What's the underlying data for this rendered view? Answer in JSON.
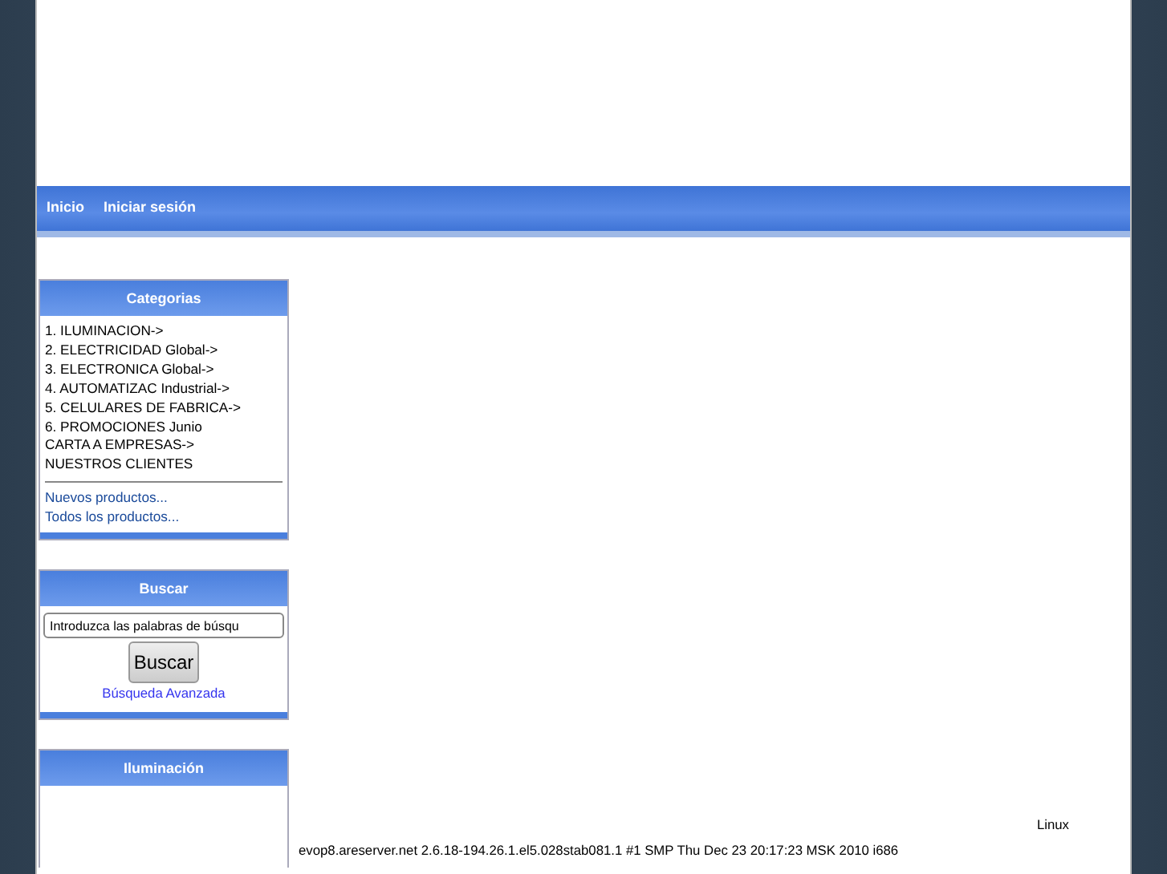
{
  "nav": [
    {
      "label": "Inicio"
    },
    {
      "label": "Iniciar sesión"
    }
  ],
  "categories": {
    "title": "Categorias",
    "items": [
      {
        "label": "1. ILUMINACION->"
      },
      {
        "label": "2. ELECTRICIDAD Global->"
      },
      {
        "label": "3. ELECTRONICA Global->"
      },
      {
        "label": "4. AUTOMATIZAC Industrial->"
      },
      {
        "label": "5. CELULARES DE FABRICA->"
      },
      {
        "label": "6. PROMOCIONES Junio"
      },
      {
        "label": "CARTA A EMPRESAS->"
      },
      {
        "label": "NUESTROS CLIENTES"
      }
    ],
    "links": [
      {
        "label": "Nuevos productos..."
      },
      {
        "label": "Todos los productos..."
      }
    ]
  },
  "search": {
    "title": "Buscar",
    "value": "Introduzca las palabras de búsqu",
    "button": "Buscar",
    "advanced_link": "Búsqueda Avanzada"
  },
  "lighting": {
    "title": "Iluminación"
  },
  "server_info": {
    "line_1": "Linux",
    "line_2": "evop8.areserver.net 2.6.18-194.26.1.el5.028stab081.1 #1 SMP Thu Dec 23 20:17:23 MSK 2010 i686"
  }
}
